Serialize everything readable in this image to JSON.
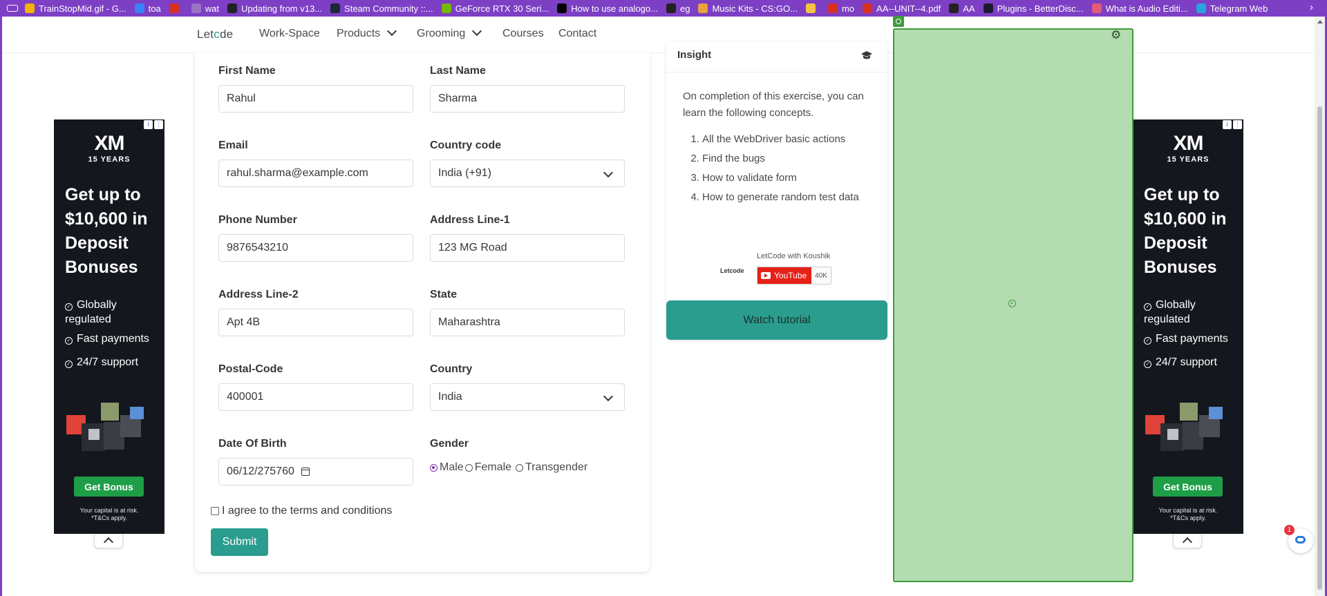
{
  "bookmarks": [
    {
      "label": "TrainStopMid.gif - G...",
      "icon": "drive-icon",
      "color": "#f4b400"
    },
    {
      "label": "toa",
      "icon": "bolt-icon",
      "color": "#3b82f6"
    },
    {
      "label": "",
      "icon": "pdf-icon",
      "color": "#d93025"
    },
    {
      "label": "wat",
      "icon": "page-icon",
      "color": "#9a73c7"
    },
    {
      "label": "Updating from v13...",
      "icon": "page-icon",
      "color": "#222222"
    },
    {
      "label": "Steam Community ::...",
      "icon": "steam-icon",
      "color": "#1b2838"
    },
    {
      "label": "GeForce RTX 30 Seri...",
      "icon": "nvidia-icon",
      "color": "#76b900"
    },
    {
      "label": "How to use analogo...",
      "icon": "medium-icon",
      "color": "#000000"
    },
    {
      "label": "eg",
      "icon": "notion-icon",
      "color": "#222222"
    },
    {
      "label": "Music Kits - CS:GO...",
      "icon": "diamond-icon",
      "color": "#e8a33d"
    },
    {
      "label": "",
      "icon": "face-icon",
      "color": "#f5c542"
    },
    {
      "label": "mo",
      "icon": "pdf-icon",
      "color": "#d93025"
    },
    {
      "label": "AA--UNIT--4.pdf",
      "icon": "pdf-icon",
      "color": "#d93025"
    },
    {
      "label": "AA",
      "icon": "notion-icon",
      "color": "#222222"
    },
    {
      "label": "Plugins - BetterDisc...",
      "icon": "betterdiscord-icon",
      "color": "#1a1a2e"
    },
    {
      "label": "What is Audio Editi...",
      "icon": "wave-icon",
      "color": "#e35b7a"
    },
    {
      "label": "Telegram Web",
      "icon": "telegram-icon",
      "color": "#2aa3df"
    }
  ],
  "nav": {
    "logo_prefix": "Let",
    "logo_c": "c",
    "logo_suffix": "de",
    "links": [
      "Work-Space",
      "Products",
      "Grooming",
      "Courses",
      "Contact"
    ]
  },
  "form": {
    "first_name_label": "First Name",
    "first_name_value": "Rahul",
    "last_name_label": "Last Name",
    "last_name_value": "Sharma",
    "email_label": "Email",
    "email_value": "rahul.sharma@example.com",
    "country_code_label": "Country code",
    "country_code_value": "India (+91)",
    "phone_label": "Phone Number",
    "phone_value": "9876543210",
    "address1_label": "Address Line-1",
    "address1_value": "123 MG Road",
    "address2_label": "Address Line-2",
    "address2_value": "Apt 4B",
    "state_label": "State",
    "state_value": "Maharashtra",
    "postal_label": "Postal-Code",
    "postal_value": "400001",
    "country_label": "Country",
    "country_value": "India",
    "dob_label": "Date Of Birth",
    "dob_value": "06/12/275760",
    "gender_label": "Gender",
    "gender_options": [
      "Male",
      "Female",
      "Transgender"
    ],
    "gender_selected": "Male",
    "terms_label": "I agree to the terms and conditions",
    "terms_checked": false,
    "submit_label": "Submit"
  },
  "insight": {
    "title": "Insight",
    "intro": "On completion of this exercise, you can learn the following concepts.",
    "concepts": [
      "All the WebDriver basic actions",
      "Find the bugs",
      "How to validate form",
      "How to generate random test data"
    ],
    "yt_logo": "Letcode",
    "yt_channel": "LetCode with Koushik",
    "yt_button": "YouTube",
    "yt_count": "40K",
    "watch_label": "Watch tutorial"
  },
  "ad": {
    "brand": "XM",
    "years": "15 YEARS",
    "headline": "Get up to $10,600 in Deposit Bonuses",
    "features": [
      "Globally regulated",
      "Fast payments",
      "24/7 support"
    ],
    "cta": "Get Bonus",
    "risk_line1": "Your capital is at risk.",
    "risk_line2": "*T&Cs apply."
  },
  "chat_badge": "1",
  "colors": {
    "accent": "#2a9d8f",
    "bookmark_bar": "#7d3fc4",
    "overlay_fill": "#b3dcb0",
    "overlay_border": "#3f9b3b",
    "ad_bg": "#14171d",
    "ad_cta": "#1e9e47"
  }
}
